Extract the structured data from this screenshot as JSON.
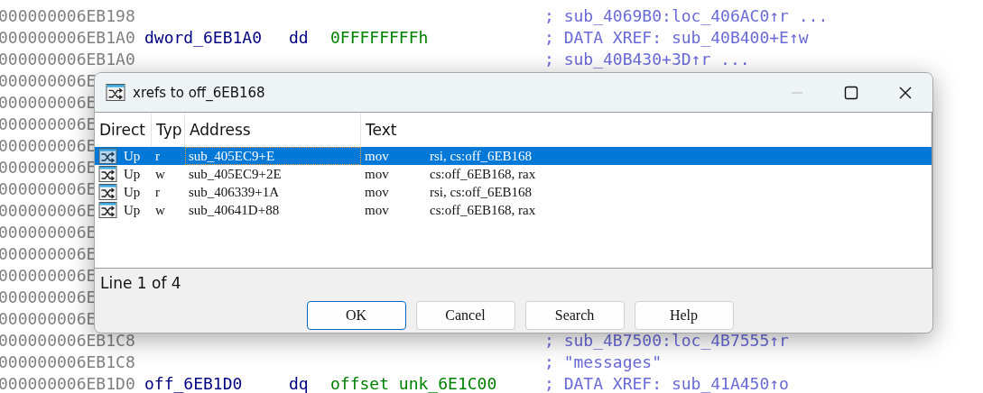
{
  "listing": [
    {
      "address": "000000006EB198",
      "comment": "; sub_4069B0:loc_406AC0↑r ..."
    },
    {
      "address": "000000006EB1A0",
      "name": "dword_6EB1A0",
      "directive": "dd",
      "value": "0FFFFFFFFh",
      "comment": "; DATA XREF: sub_40B400+E↑w"
    },
    {
      "address": "000000006EB1A0",
      "comment": "; sub_40B430+3D↑r ..."
    },
    {
      "address": "000000006E"
    },
    {
      "address": "000000006E"
    },
    {
      "address": "000000006E"
    },
    {
      "address": "000000006E"
    },
    {
      "address": "000000006E"
    },
    {
      "address": "000000006E"
    },
    {
      "address": "000000006E"
    },
    {
      "address": "000000006E"
    },
    {
      "address": "000000006E"
    },
    {
      "address": "000000006E"
    },
    {
      "address": "000000006E"
    },
    {
      "address": "000000006E"
    },
    {
      "address": "000000006EB1C8",
      "comment": "; sub_4B7500:loc_4B7555↑r"
    },
    {
      "address": "000000006EB1C8",
      "comment": "; \"messages\""
    },
    {
      "address": "000000006EB1D0",
      "name": "off_6EB1D0",
      "directive": "dq",
      "value": "offset unk_6E1C00",
      "comment": "; DATA XREF: sub_41A450↑o"
    }
  ],
  "dialog": {
    "title": "xrefs to off_6EB168",
    "columns": [
      "Direct",
      "Typ",
      "Address",
      "Text"
    ],
    "rows": [
      {
        "selected": true,
        "direction": "Up",
        "type": "r",
        "address": "sub_405EC9+E",
        "instruction": "mov",
        "operands": "rsi, cs:off_6EB168"
      },
      {
        "selected": false,
        "direction": "Up",
        "type": "w",
        "address": "sub_405EC9+2E",
        "instruction": "mov",
        "operands": "cs:off_6EB168, rax"
      },
      {
        "selected": false,
        "direction": "Up",
        "type": "r",
        "address": "sub_406339+1A",
        "instruction": "mov",
        "operands": "rsi, cs:off_6EB168"
      },
      {
        "selected": false,
        "direction": "Up",
        "type": "w",
        "address": "sub_40641D+88",
        "instruction": "mov",
        "operands": "cs:off_6EB168, rax"
      }
    ],
    "status": "Line 1 of 4",
    "buttons": [
      {
        "label": "OK",
        "default": true
      },
      {
        "label": "Cancel",
        "default": false
      },
      {
        "label": "Search",
        "default": false
      },
      {
        "label": "Help",
        "default": false
      }
    ]
  }
}
